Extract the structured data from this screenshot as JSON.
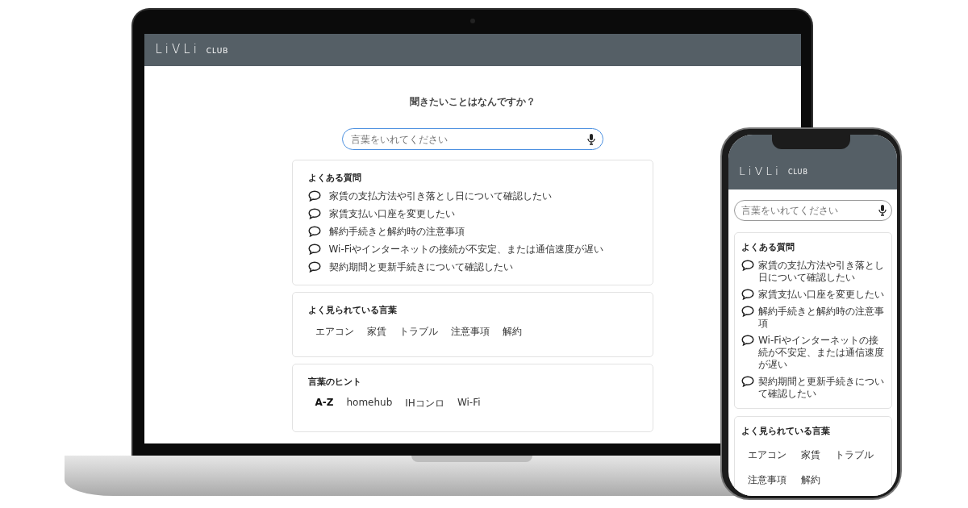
{
  "laptop": {
    "header": {
      "logo": "LiVLi",
      "logo_sub": "CLUB"
    },
    "heading": "聞きたいことはなんですか？",
    "search": {
      "placeholder": "言葉をいれてください"
    },
    "faq": {
      "title": "よくある質問",
      "items": [
        "家賃の支払方法や引き落とし日について確認したい",
        "家賃支払い口座を変更したい",
        "解約手続きと解約時の注意事項",
        "Wi-Fiやインターネットの接続が不安定、または通信速度が遅い",
        "契約期間と更新手続きについて確認したい"
      ]
    },
    "popular": {
      "title": "よく見られている言葉",
      "words": [
        {
          "label": "エアコン",
          "selected": false
        },
        {
          "label": "家賃",
          "selected": false
        },
        {
          "label": "トラブル",
          "selected": false
        },
        {
          "label": "注意事項",
          "selected": false
        },
        {
          "label": "解約",
          "selected": false
        }
      ]
    },
    "hints": {
      "title": "言葉のヒント",
      "words": [
        {
          "label": "A-Z",
          "selected": true
        },
        {
          "label": "homehub",
          "selected": false
        },
        {
          "label": "IHコンロ",
          "selected": false
        },
        {
          "label": "Wi-Fi",
          "selected": false
        }
      ]
    }
  },
  "phone": {
    "header": {
      "logo": "LiVLi",
      "logo_sub": "CLUB"
    },
    "search": {
      "placeholder": "言葉をいれてください"
    },
    "faq": {
      "title": "よくある質問",
      "items": [
        "家賃の支払方法や引き落とし日について確認したい",
        "家賃支払い口座を変更したい",
        "解約手続きと解約時の注意事項",
        "Wi-Fiやインターネットの接続が不安定、または通信速度が遅い",
        "契約期間と更新手続きについて確認したい"
      ]
    },
    "popular": {
      "title": "よく見られている言葉",
      "words": [
        {
          "label": "エアコン",
          "selected": false
        },
        {
          "label": "家賃",
          "selected": false
        },
        {
          "label": "トラブル",
          "selected": false
        },
        {
          "label": "注意事項",
          "selected": false
        },
        {
          "label": "解約",
          "selected": false
        }
      ]
    }
  }
}
